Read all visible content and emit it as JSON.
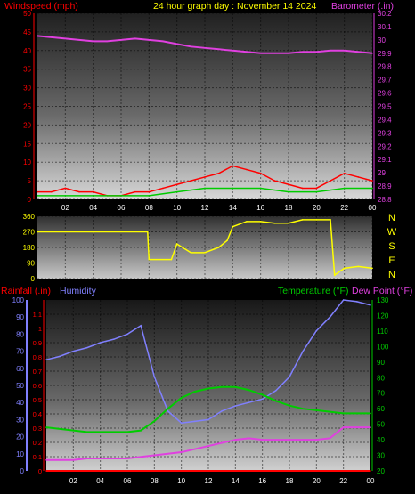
{
  "header": {
    "left_label": "Windspeed (mph)",
    "title": "24 hour graph day : November 14 2024",
    "right_label": "Barometer (.in)"
  },
  "colors": {
    "windspeed": "#ff0000",
    "gust_axis": "#ff0000",
    "wind_avg": "#00cc00",
    "wind_low": "#ffffff",
    "barometer": "#e040e0",
    "direction": "#ffff00",
    "rainfall": "#ff0000",
    "humidity": "#8080ff",
    "temperature": "#00cc00",
    "dewpoint": "#e040e0"
  },
  "bottom_header": {
    "rainfall_label": "Rainfall (.in)",
    "humidity_label": "Humidity",
    "temperature_label": "Temperature (°F)",
    "dewpoint_label": "Dew Point (°F)"
  },
  "chart_data": [
    {
      "type": "line",
      "title": "24 hour graph day : November 14 2024",
      "x_ticks": [
        "02",
        "04",
        "06",
        "08",
        "10",
        "12",
        "14",
        "16",
        "18",
        "20",
        "22",
        "00"
      ],
      "x_range_hours": [
        0,
        24
      ],
      "left_axis": {
        "label": "Windspeed (mph)",
        "range": [
          0,
          50
        ],
        "ticks": [
          0,
          5,
          10,
          15,
          20,
          25,
          30,
          35,
          40,
          45,
          50
        ]
      },
      "right_axis": {
        "label": "Barometer (.in)",
        "range": [
          28.8,
          30.2
        ],
        "ticks": [
          "28.8",
          "28.9",
          "29",
          "29.1",
          "29.2",
          "29.3",
          "29.4",
          "29.5",
          "29.6",
          "29.7",
          "29.8",
          "29.9",
          "30",
          "30.1",
          "30.2"
        ]
      },
      "series": [
        {
          "name": "Windspeed (mph)",
          "axis": "left",
          "x": [
            0,
            1,
            2,
            3,
            4,
            5,
            6,
            7,
            8,
            9,
            10,
            11,
            12,
            13,
            14,
            15,
            16,
            17,
            18,
            19,
            20,
            21,
            22,
            23,
            24
          ],
          "y": [
            2,
            2,
            3,
            2,
            2,
            1,
            1,
            2,
            2,
            3,
            4,
            5,
            6,
            7,
            9,
            8,
            7,
            5,
            4,
            3,
            3,
            5,
            7,
            6,
            5
          ]
        },
        {
          "name": "",
          "axis": "left",
          "x": [
            0,
            2,
            4,
            6,
            8,
            10,
            12,
            14,
            16,
            18,
            20,
            22,
            24
          ],
          "y": [
            1,
            1,
            1,
            1,
            1,
            2,
            3,
            3,
            3,
            2,
            2,
            3,
            3
          ]
        },
        {
          "name": "Barometer (.in)",
          "axis": "right",
          "x": [
            0,
            1,
            2,
            3,
            4,
            5,
            6,
            7,
            8,
            9,
            10,
            11,
            12,
            13,
            14,
            15,
            16,
            17,
            18,
            19,
            20,
            21,
            22,
            23,
            24
          ],
          "y": [
            30.03,
            30.02,
            30.01,
            30.0,
            29.99,
            29.99,
            30.0,
            30.01,
            30.0,
            29.99,
            29.97,
            29.95,
            29.94,
            29.93,
            29.92,
            29.91,
            29.9,
            29.9,
            29.9,
            29.91,
            29.91,
            29.92,
            29.92,
            29.91,
            29.9
          ]
        }
      ]
    },
    {
      "type": "line",
      "title": "",
      "y_range": [
        0,
        360
      ],
      "y_ticks": [
        0,
        90,
        180,
        270,
        360
      ],
      "compass_labels": [
        "N",
        "W",
        "S",
        "E",
        "N"
      ],
      "x_ticks": [
        "02",
        "04",
        "06",
        "08",
        "10",
        "12",
        "14",
        "16",
        "18",
        "20",
        "22",
        "00"
      ],
      "series": [
        {
          "name": "",
          "x": [
            0,
            4,
            7.9,
            8,
            9.6,
            10,
            11,
            12,
            13,
            13.6,
            14,
            15,
            16,
            17,
            18,
            19,
            20,
            21,
            21.3,
            22,
            23,
            24
          ],
          "y": [
            270,
            270,
            270,
            110,
            110,
            200,
            150,
            150,
            180,
            220,
            300,
            330,
            330,
            320,
            320,
            340,
            340,
            340,
            20,
            60,
            70,
            60
          ]
        }
      ]
    },
    {
      "type": "line",
      "title": "",
      "left_axis": {
        "label": "Humidity",
        "range": [
          0,
          100
        ],
        "ticks": [
          0,
          10,
          20,
          30,
          40,
          50,
          60,
          70,
          80,
          90,
          100
        ]
      },
      "rain_axis": {
        "label": "Rainfall (.in)",
        "range": [
          0,
          1.2
        ],
        "ticks": [
          "0",
          "0.1",
          "0.2",
          "0.3",
          "0.4",
          "0.5",
          "0.6",
          "0.7",
          "0.8",
          "0.9",
          "1",
          "1.1"
        ]
      },
      "right_axis": {
        "label": "Temperature (°F) Dew Point (°F)",
        "range": [
          20,
          130
        ],
        "ticks": [
          20,
          30,
          40,
          50,
          60,
          70,
          80,
          90,
          100,
          110,
          120,
          130
        ]
      },
      "x_ticks": [
        "02",
        "04",
        "06",
        "08",
        "10",
        "12",
        "14",
        "16",
        "18",
        "20",
        "22",
        "00"
      ],
      "series": [
        {
          "name": "Humidity",
          "axis": "left",
          "x": [
            0,
            1,
            2,
            3,
            4,
            5,
            6,
            7,
            8,
            9,
            10,
            11,
            12,
            13,
            14,
            15,
            16,
            17,
            18,
            19,
            20,
            21,
            22,
            23,
            24
          ],
          "y": [
            65,
            67,
            70,
            72,
            75,
            77,
            80,
            85,
            55,
            35,
            28,
            29,
            30,
            35,
            38,
            40,
            42,
            47,
            55,
            70,
            82,
            90,
            100,
            99,
            97
          ]
        },
        {
          "name": "Temperature (°F)",
          "axis": "right",
          "x": [
            0,
            1,
            2,
            3,
            4,
            5,
            6,
            7,
            8,
            9,
            10,
            11,
            12,
            13,
            14,
            15,
            16,
            17,
            18,
            19,
            20,
            21,
            22,
            23,
            24
          ],
          "y": [
            48,
            47,
            46,
            45,
            45,
            45,
            45,
            46,
            52,
            60,
            67,
            71,
            73,
            74,
            74,
            72,
            69,
            65,
            62,
            60,
            59,
            58,
            57,
            57,
            57
          ]
        },
        {
          "name": "Dew Point (°F)",
          "axis": "right",
          "x": [
            0,
            1,
            2,
            3,
            4,
            5,
            6,
            7,
            8,
            9,
            10,
            11,
            12,
            13,
            14,
            15,
            16,
            17,
            18,
            19,
            20,
            21,
            22,
            23,
            24
          ],
          "y": [
            27,
            27,
            27,
            28,
            28,
            28,
            28,
            29,
            30,
            31,
            32,
            34,
            36,
            38,
            40,
            41,
            40,
            40,
            40,
            40,
            40,
            41,
            48,
            48,
            48
          ]
        },
        {
          "name": "Rainfall (.in)",
          "axis": "rain",
          "x": [
            0,
            24
          ],
          "y": [
            0,
            0
          ]
        }
      ]
    }
  ]
}
